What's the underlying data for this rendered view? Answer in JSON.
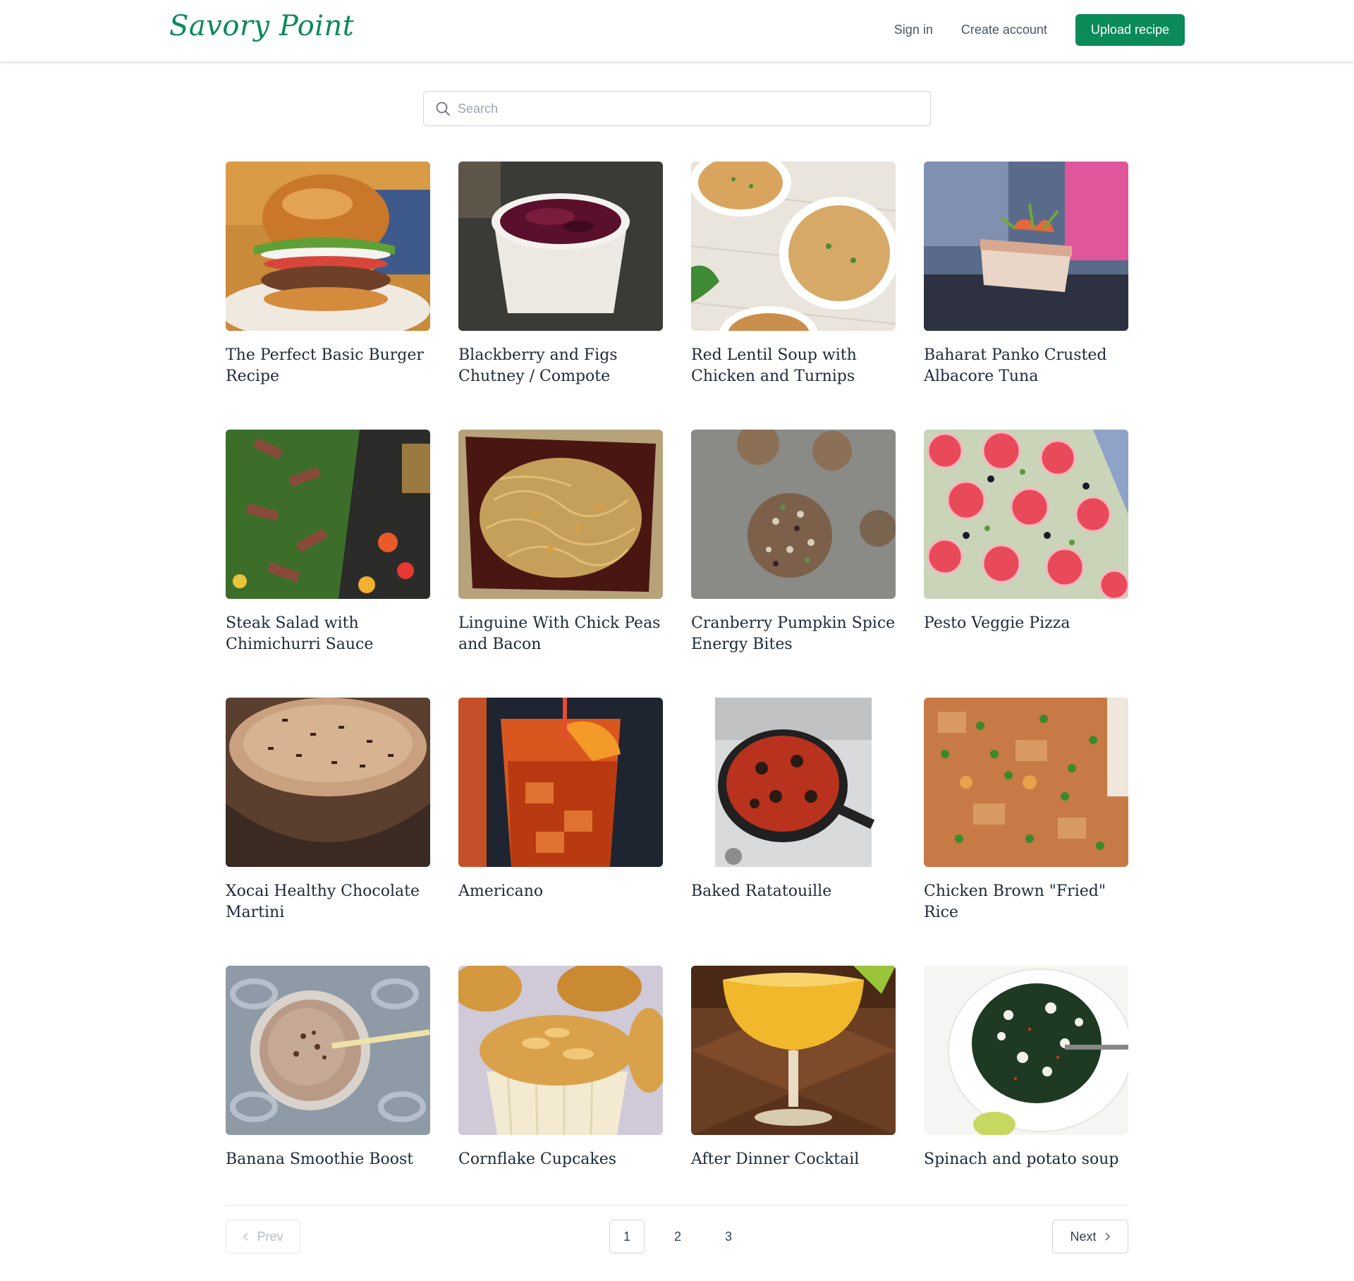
{
  "header": {
    "brand": "Savory Point",
    "sign_in": "Sign in",
    "create_account": "Create account",
    "upload": "Upload recipe"
  },
  "search": {
    "placeholder": "Search",
    "value": ""
  },
  "recipes": [
    {
      "title": "The Perfect Basic Burger Recipe",
      "image": "burger"
    },
    {
      "title": "Blackberry and Figs Chutney / Compote",
      "image": "chutney-bowl"
    },
    {
      "title": "Red Lentil Soup with Chicken and Turnips",
      "image": "soup-bowls"
    },
    {
      "title": "Baharat Panko Crusted Albacore Tuna",
      "image": "tuna"
    },
    {
      "title": "Steak Salad with Chimichurri Sauce",
      "image": "steak-salad"
    },
    {
      "title": "Linguine With Chick Peas and Bacon",
      "image": "linguine"
    },
    {
      "title": "Cranberry Pumpkin Spice Energy Bites",
      "image": "energy-bites"
    },
    {
      "title": "Pesto Veggie Pizza",
      "image": "pizza"
    },
    {
      "title": "Xocai Healthy Chocolate Martini",
      "image": "martini"
    },
    {
      "title": "Americano",
      "image": "americano-glass"
    },
    {
      "title": "Baked Ratatouille",
      "image": "skillet"
    },
    {
      "title": "Chicken Brown \"Fried\" Rice",
      "image": "fried-rice"
    },
    {
      "title": "Banana Smoothie Boost",
      "image": "smoothie"
    },
    {
      "title": "Cornflake Cupcakes",
      "image": "cupcakes"
    },
    {
      "title": "After Dinner Cocktail",
      "image": "cocktail"
    },
    {
      "title": "Spinach and potato soup",
      "image": "spinach-soup"
    }
  ],
  "pagination": {
    "prev": "Prev",
    "next": "Next",
    "pages": [
      "1",
      "2",
      "3"
    ],
    "current": "1"
  },
  "colors": {
    "accent": "#0b8a5a"
  }
}
